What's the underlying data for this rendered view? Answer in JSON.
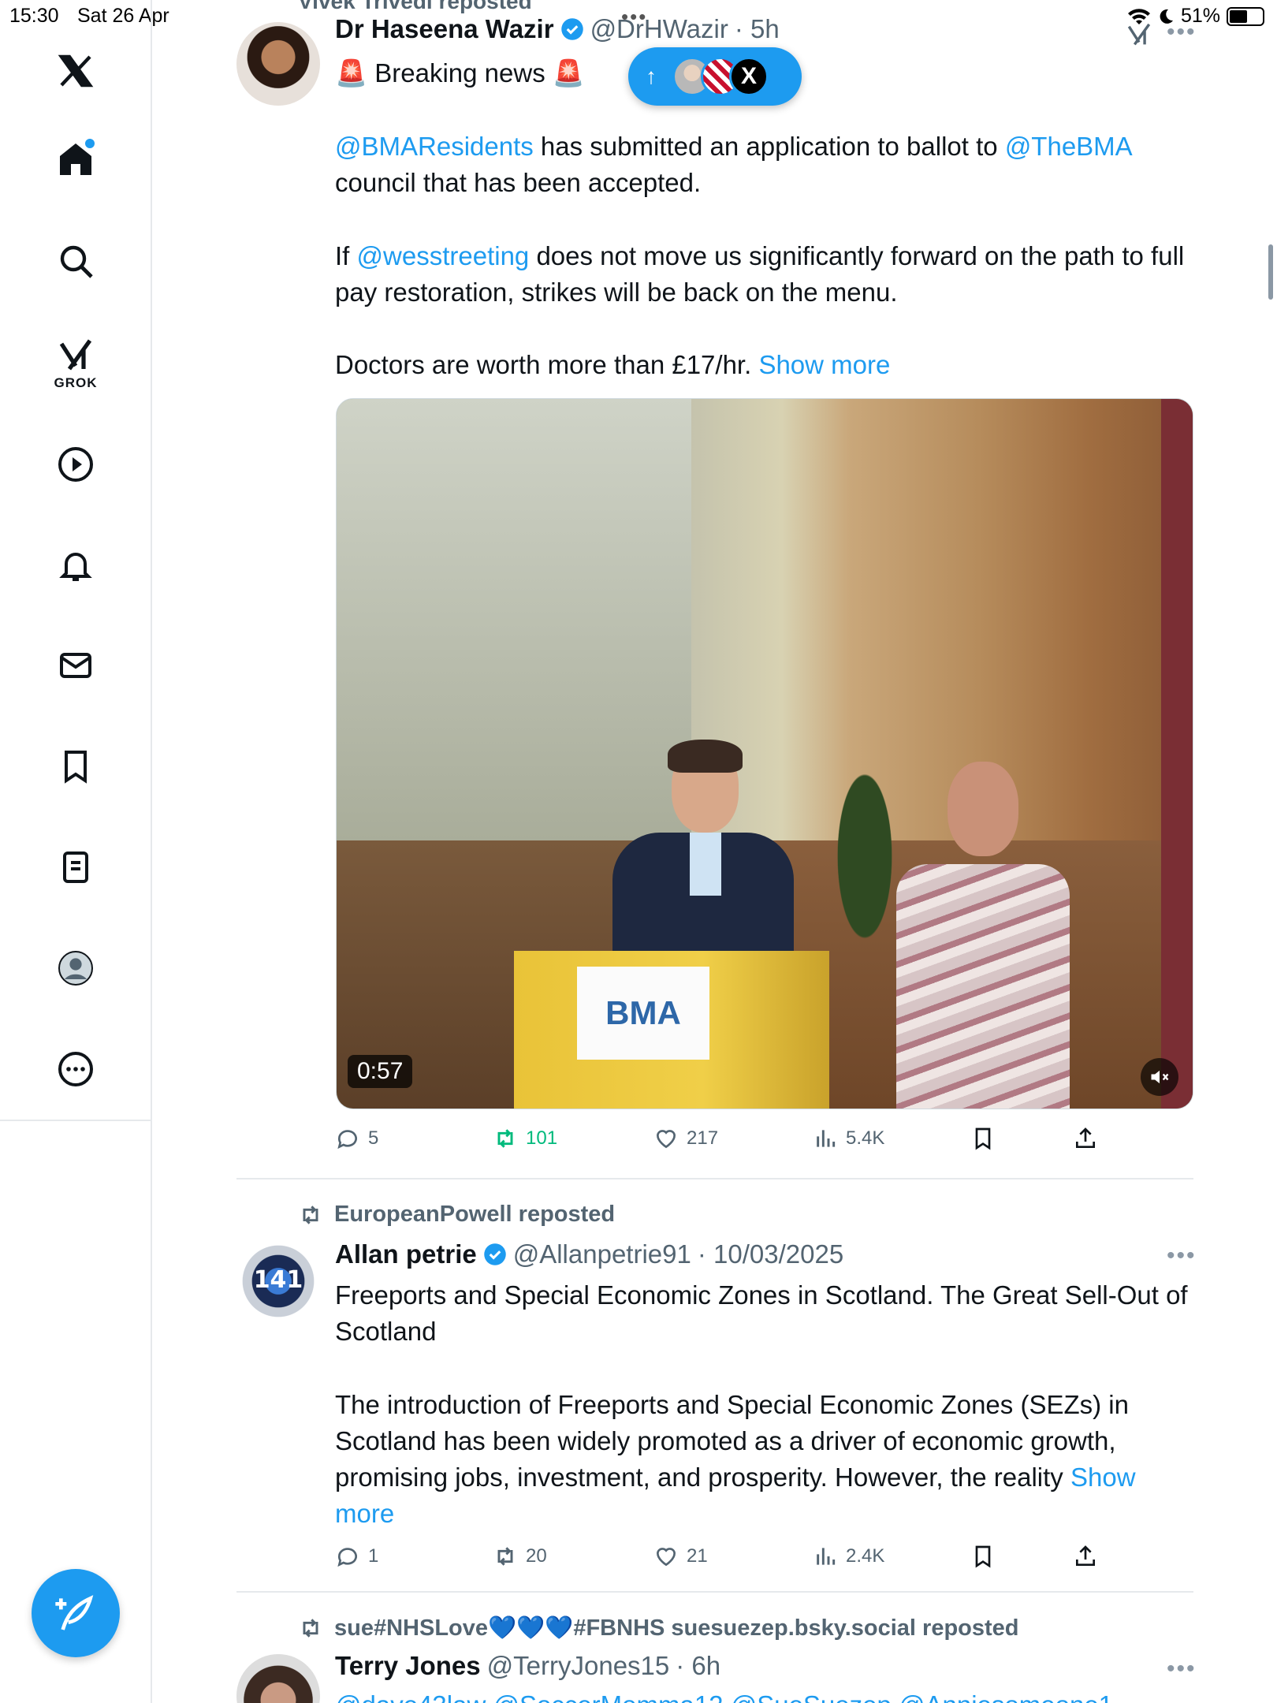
{
  "status_bar": {
    "time": "15:30",
    "date": "Sat 26 Apr",
    "battery": "51%"
  },
  "sidebar": {
    "items": [
      {
        "name": "home",
        "icon": "home-icon",
        "has_notification_dot": true
      },
      {
        "name": "explore",
        "icon": "search-icon"
      },
      {
        "name": "grok",
        "icon": "grok-icon",
        "label": "GROK"
      },
      {
        "name": "video",
        "icon": "play-icon"
      },
      {
        "name": "notifications",
        "icon": "bell-icon"
      },
      {
        "name": "messages",
        "icon": "mail-icon"
      },
      {
        "name": "bookmarks",
        "icon": "bookmark-icon"
      },
      {
        "name": "lists",
        "icon": "list-icon"
      },
      {
        "name": "profile",
        "icon": "profile-icon"
      },
      {
        "name": "more",
        "icon": "more-icon"
      }
    ],
    "compose_icon": "compose-icon"
  },
  "feed": {
    "top_cut_text": "Vivek Trivedi reposted",
    "new_posts_pill": {
      "arrow": "↑",
      "avatar3_letter": "X"
    },
    "tweets": [
      {
        "name": "Dr Haseena Wazir",
        "handle": "@DrHWazir",
        "time": "· 5h",
        "line1": "🚨 Breaking news 🚨",
        "para1_mention1": "@BMAResidents",
        "para1_mid": " has submitted an application to ballot to ",
        "para1_mention2": "@TheBMA",
        "para1_end": " council that has been accepted.",
        "para2_start": "If ",
        "para2_mention": "@wesstreeting",
        "para2_end": " does not move us significantly forward on the path to full pay restoration, strikes will be back on the menu.",
        "para3": "Doctors are worth more than £17/hr. ",
        "show_more": "Show more",
        "video": {
          "duration": "0:57",
          "podium_sign": "BMA"
        },
        "stats": {
          "replies": "5",
          "reposts": "101",
          "likes": "217",
          "views": "5.4K"
        }
      },
      {
        "reposted_by": "EuropeanPowell reposted",
        "name": "Allan petrie",
        "handle": "@Allanpetrie91",
        "time": "· 10/03/2025",
        "avatar_text": "141",
        "para1": "Freeports and Special Economic Zones in Scotland. The Great Sell-Out of Scotland",
        "para2": "The introduction of Freeports and Special Economic Zones (SEZs) in Scotland has been widely promoted as a driver of economic growth, promising jobs, investment, and prosperity. However, the reality ",
        "show_more": "Show more",
        "stats": {
          "replies": "1",
          "reposts": "20",
          "likes": "21",
          "views": "2.4K"
        }
      },
      {
        "reposted_by": "sue#NHSLove💙💙💙#FBNHS suesuezep.bsky.social reposted",
        "name": "Terry Jones",
        "handle": "@TerryJones15",
        "time": "· 6h",
        "cut_text": "@dave43law @SoccerMomma12 @SueSuezep @Anniesomeone1"
      }
    ]
  },
  "colors": {
    "accent": "#1d9bf0",
    "repost_green": "#00ba7c",
    "secondary_text": "#536471"
  }
}
